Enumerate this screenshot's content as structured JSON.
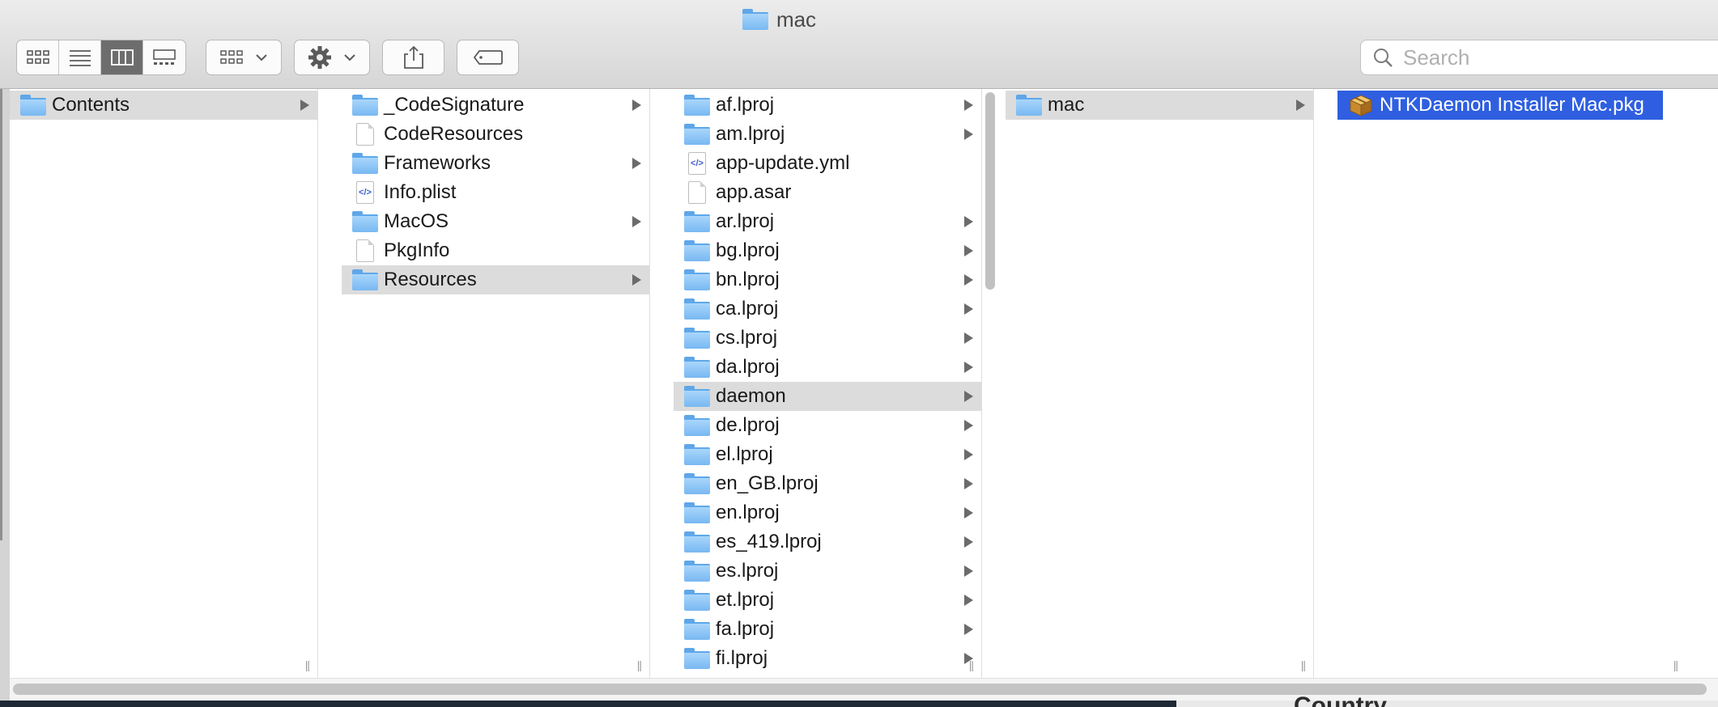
{
  "window": {
    "title": "mac"
  },
  "toolbar": {
    "view_buttons": [
      "icon-view",
      "list-view",
      "column-view",
      "gallery-view"
    ],
    "group_button": "group-icon",
    "action_button": "gear-icon",
    "share_button": "share-icon",
    "tag_button": "tag-icon"
  },
  "search": {
    "placeholder": "Search",
    "value": ""
  },
  "columns": [
    {
      "items": [
        {
          "name": "Contents",
          "kind": "folder",
          "arrow": true,
          "selected": "gray"
        }
      ]
    },
    {
      "items": [
        {
          "name": "_CodeSignature",
          "kind": "folder",
          "arrow": true
        },
        {
          "name": "CodeResources",
          "kind": "file",
          "arrow": false
        },
        {
          "name": "Frameworks",
          "kind": "folder",
          "arrow": true
        },
        {
          "name": "Info.plist",
          "kind": "plist",
          "arrow": false
        },
        {
          "name": "MacOS",
          "kind": "folder",
          "arrow": true
        },
        {
          "name": "PkgInfo",
          "kind": "file",
          "arrow": false
        },
        {
          "name": "Resources",
          "kind": "folder",
          "arrow": true,
          "selected": "gray"
        }
      ]
    },
    {
      "items": [
        {
          "name": "af.lproj",
          "kind": "folder",
          "arrow": true
        },
        {
          "name": "am.lproj",
          "kind": "folder",
          "arrow": true
        },
        {
          "name": "app-update.yml",
          "kind": "plist",
          "arrow": false
        },
        {
          "name": "app.asar",
          "kind": "file",
          "arrow": false
        },
        {
          "name": "ar.lproj",
          "kind": "folder",
          "arrow": true
        },
        {
          "name": "bg.lproj",
          "kind": "folder",
          "arrow": true
        },
        {
          "name": "bn.lproj",
          "kind": "folder",
          "arrow": true
        },
        {
          "name": "ca.lproj",
          "kind": "folder",
          "arrow": true
        },
        {
          "name": "cs.lproj",
          "kind": "folder",
          "arrow": true
        },
        {
          "name": "da.lproj",
          "kind": "folder",
          "arrow": true
        },
        {
          "name": "daemon",
          "kind": "folder",
          "arrow": true,
          "selected": "gray"
        },
        {
          "name": "de.lproj",
          "kind": "folder",
          "arrow": true
        },
        {
          "name": "el.lproj",
          "kind": "folder",
          "arrow": true
        },
        {
          "name": "en_GB.lproj",
          "kind": "folder",
          "arrow": true
        },
        {
          "name": "en.lproj",
          "kind": "folder",
          "arrow": true
        },
        {
          "name": "es_419.lproj",
          "kind": "folder",
          "arrow": true
        },
        {
          "name": "es.lproj",
          "kind": "folder",
          "arrow": true
        },
        {
          "name": "et.lproj",
          "kind": "folder",
          "arrow": true
        },
        {
          "name": "fa.lproj",
          "kind": "folder",
          "arrow": true
        },
        {
          "name": "fi.lproj",
          "kind": "folder",
          "arrow": true
        }
      ]
    },
    {
      "items": [
        {
          "name": "mac",
          "kind": "folder",
          "arrow": true,
          "selected": "gray"
        }
      ]
    },
    {
      "items": [
        {
          "name": "NTKDaemon Installer Mac.pkg",
          "kind": "package",
          "arrow": false,
          "selected": "blue"
        }
      ]
    }
  ],
  "background": {
    "partial_text": "Country"
  },
  "colors": {
    "selection_blue": "#2f5fe0",
    "selection_gray": "#dcdcdc",
    "folder_blue": "#78b8f2"
  }
}
